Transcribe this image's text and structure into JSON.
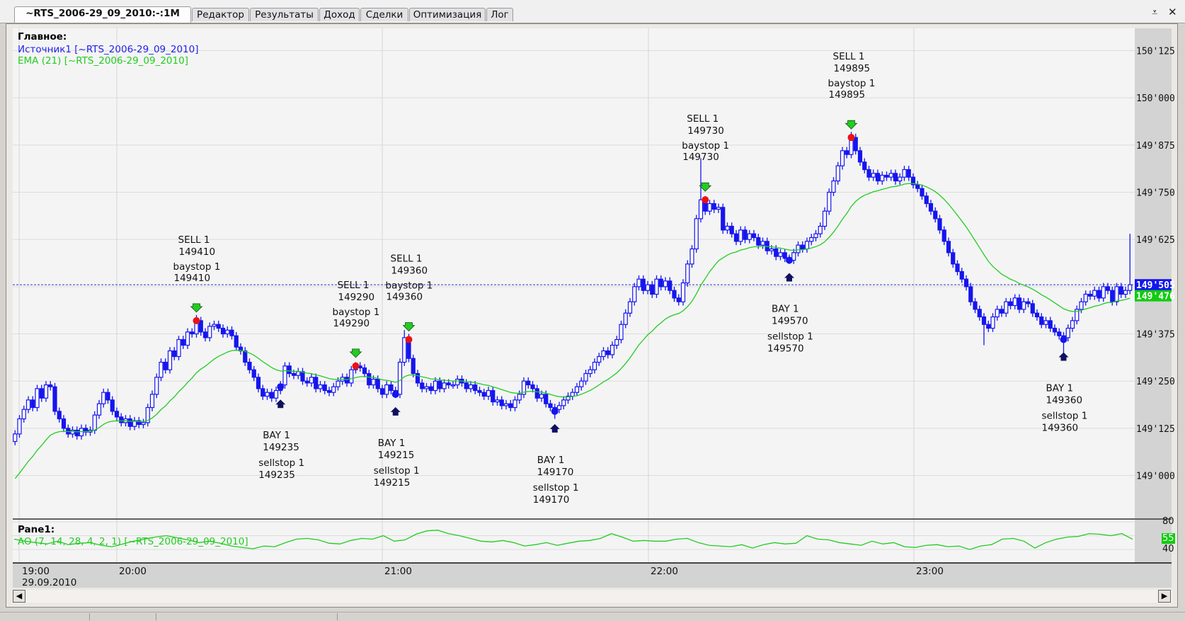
{
  "tabs": [
    {
      "label": "~RTS_2006-29_09_2010:-:1M",
      "active": true
    },
    {
      "label": "Редактор"
    },
    {
      "label": "Результаты"
    },
    {
      "label": "Доход"
    },
    {
      "label": "Сделки"
    },
    {
      "label": "Оптимизация"
    },
    {
      "label": "Лог"
    }
  ],
  "window_controls": {
    "menu_icon": "dropdown-menu-icon",
    "close_icon": "close-icon"
  },
  "main_pane": {
    "title": "Главное:",
    "source_legend": "Источник1 [~RTS_2006-29_09_2010]",
    "ema_legend": "EMA (21) [~RTS_2006-29_09_2010]"
  },
  "sub_pane": {
    "title": "Pane1:",
    "ao_legend": "AO (7, 14, 28, 4, 2, 1) [~RTS_2006-29_09_2010]",
    "scale_labels": [
      "80",
      "40"
    ],
    "current_value": "55"
  },
  "time_axis": {
    "first_label": "19:00",
    "date": "29.09.2010",
    "labels": [
      "20:00",
      "21:00",
      "22:00",
      "23:00"
    ]
  },
  "colors": {
    "candle": "#1515ee",
    "ema": "#22cc22",
    "ao": "#22cc22",
    "sell_dot": "#ee1111",
    "sell_arrow": "#22cc22",
    "buy_arrow": "#101060",
    "last_price_bg": "#1515ee",
    "ema_price_bg": "#11cc11"
  },
  "chart_data": {
    "type": "candlestick",
    "symbol": "~RTS_2006-29_09_2010",
    "interval": "1M",
    "first_candle_time": "19:37",
    "price_ticks": [
      "150'125",
      "150'000",
      "149'875",
      "149'750",
      "149'625",
      "149'375",
      "149'250",
      "149'125",
      "149'000"
    ],
    "price_tick_values": [
      150125,
      150000,
      149875,
      149750,
      149625,
      149375,
      149250,
      149125,
      149000
    ],
    "last_price": 149505,
    "last_price_label": "149'505",
    "ema_last_label": "149'476",
    "ema_period": 21,
    "ema_start": 148980,
    "first_open": 149090,
    "closes": [
      149110,
      149150,
      149175,
      149200,
      149180,
      149230,
      149205,
      149240,
      149235,
      149170,
      149150,
      149125,
      149110,
      149120,
      149105,
      149125,
      149115,
      149120,
      149160,
      149190,
      149220,
      149200,
      149170,
      149155,
      149140,
      149150,
      149130,
      149145,
      149135,
      149140,
      149180,
      149215,
      149260,
      149300,
      149280,
      149330,
      149315,
      149360,
      149345,
      149380,
      149375,
      149410,
      149380,
      149365,
      149395,
      149400,
      149390,
      149375,
      149385,
      149370,
      149340,
      149330,
      149300,
      149280,
      149260,
      149230,
      149210,
      149220,
      149205,
      149225,
      149240,
      149290,
      149270,
      149265,
      149275,
      149250,
      149245,
      149260,
      149230,
      149240,
      149225,
      149220,
      149235,
      149250,
      149260,
      149245,
      149280,
      149290,
      149285,
      149270,
      149240,
      149255,
      149230,
      149215,
      149240,
      149225,
      149215,
      149300,
      149365,
      149310,
      149270,
      149245,
      149230,
      149235,
      149225,
      149250,
      149230,
      149245,
      149240,
      149240,
      149255,
      149245,
      149230,
      149240,
      149225,
      149220,
      149210,
      149225,
      149195,
      149200,
      149185,
      149190,
      149180,
      149200,
      149215,
      149250,
      149240,
      149230,
      149205,
      149215,
      149190,
      149180,
      149175,
      149185,
      149200,
      149210,
      149220,
      149235,
      149250,
      149270,
      149280,
      149300,
      149315,
      149330,
      149320,
      149345,
      149360,
      149400,
      149430,
      149460,
      149500,
      149520,
      149490,
      149505,
      149480,
      149520,
      149500,
      149515,
      149490,
      149470,
      149460,
      149510,
      149560,
      149600,
      149680,
      149730,
      149700,
      149720,
      149705,
      149710,
      149650,
      149660,
      149640,
      149620,
      149650,
      149625,
      149640,
      149630,
      149610,
      149620,
      149595,
      149600,
      149580,
      149590,
      149575,
      149570,
      149590,
      149610,
      149600,
      149620,
      149630,
      149640,
      149660,
      149700,
      149750,
      149780,
      149820,
      149860,
      149850,
      149895,
      149860,
      149830,
      149810,
      149790,
      149800,
      149780,
      149795,
      149790,
      149800,
      149780,
      149790,
      149810,
      149790,
      149770,
      149760,
      149740,
      149720,
      149700,
      149680,
      149650,
      149620,
      149590,
      149560,
      149540,
      149520,
      149500,
      149460,
      149440,
      149420,
      149400,
      149390,
      149420,
      149440,
      149430,
      149460,
      149450,
      149470,
      149440,
      149460,
      149455,
      149430,
      149420,
      149400,
      149410,
      149390,
      149380,
      149370,
      149365,
      149390,
      149410,
      149440,
      149460,
      149480,
      149475,
      149490,
      149470,
      149500,
      149490,
      149460,
      149500,
      149480,
      149490,
      149505
    ],
    "wick_extremes": [
      {
        "index": 41,
        "high": 149425
      },
      {
        "index": 88,
        "high": 149385
      },
      {
        "index": 122,
        "low": 149150
      },
      {
        "index": 155,
        "high": 149840
      },
      {
        "index": 189,
        "high": 149910
      },
      {
        "index": 219,
        "low": 149345
      },
      {
        "index": 237,
        "low": 149325
      },
      {
        "index": 252,
        "high": 149640
      }
    ],
    "signals": [
      {
        "type": "sell",
        "index": 41,
        "price": 149410,
        "lines": [
          "SELL 1",
          "149410",
          "baystop 1",
          "149410"
        ]
      },
      {
        "type": "buy",
        "index": 60,
        "price": 149235,
        "lines": [
          "BAY 1",
          "149235",
          "sellstop 1",
          "149235"
        ]
      },
      {
        "type": "sell",
        "index": 77,
        "price": 149290,
        "lines": [
          "SELL 1",
          "149290",
          "baystop 1",
          "149290"
        ]
      },
      {
        "type": "buy",
        "index": 86,
        "price": 149215,
        "lines": [
          "BAY 1",
          "149215",
          "sellstop 1",
          "149215"
        ]
      },
      {
        "type": "sell",
        "index": 89,
        "price": 149360,
        "lines": [
          "SELL 1",
          "149360",
          "baystop 1",
          "149360"
        ]
      },
      {
        "type": "buy",
        "index": 122,
        "price": 149170,
        "lines": [
          "BAY 1",
          "149170",
          "sellstop 1",
          "149170"
        ]
      },
      {
        "type": "sell",
        "index": 156,
        "price": 149730,
        "lines": [
          "SELL 1",
          "149730",
          "baystop 1",
          "149730"
        ]
      },
      {
        "type": "buy",
        "index": 175,
        "price": 149570,
        "lines": [
          "BAY 1",
          "149570",
          "sellstop 1",
          "149570"
        ]
      },
      {
        "type": "sell",
        "index": 189,
        "price": 149895,
        "lines": [
          "SELL 1",
          "149895",
          "baystop 1",
          "149895"
        ]
      },
      {
        "type": "buy",
        "index": 237,
        "price": 149360,
        "lines": [
          "BAY 1",
          "149360",
          "sellstop 1",
          "149360"
        ]
      }
    ],
    "ao": {
      "range": [
        40,
        80
      ],
      "values": [
        55,
        52,
        50,
        48,
        52,
        47,
        49,
        50,
        46,
        44,
        48,
        52,
        55,
        58,
        60,
        57,
        54,
        50,
        52,
        49,
        45,
        43,
        41,
        45,
        44,
        50,
        55,
        56,
        54,
        49,
        48,
        53,
        56,
        55,
        60,
        52,
        54,
        62,
        67,
        68,
        63,
        60,
        56,
        52,
        51,
        53,
        50,
        45,
        47,
        50,
        46,
        49,
        52,
        53,
        56,
        63,
        58,
        52,
        53,
        52,
        52,
        55,
        56,
        50,
        46,
        45,
        44,
        47,
        42,
        47,
        50,
        48,
        49,
        60,
        55,
        54,
        50,
        48,
        46,
        52,
        48,
        50,
        44,
        43,
        46,
        47,
        44,
        45,
        40,
        45,
        47,
        55,
        56,
        52,
        42,
        50,
        55,
        58,
        59,
        63,
        62,
        60,
        63,
        55
      ]
    }
  }
}
